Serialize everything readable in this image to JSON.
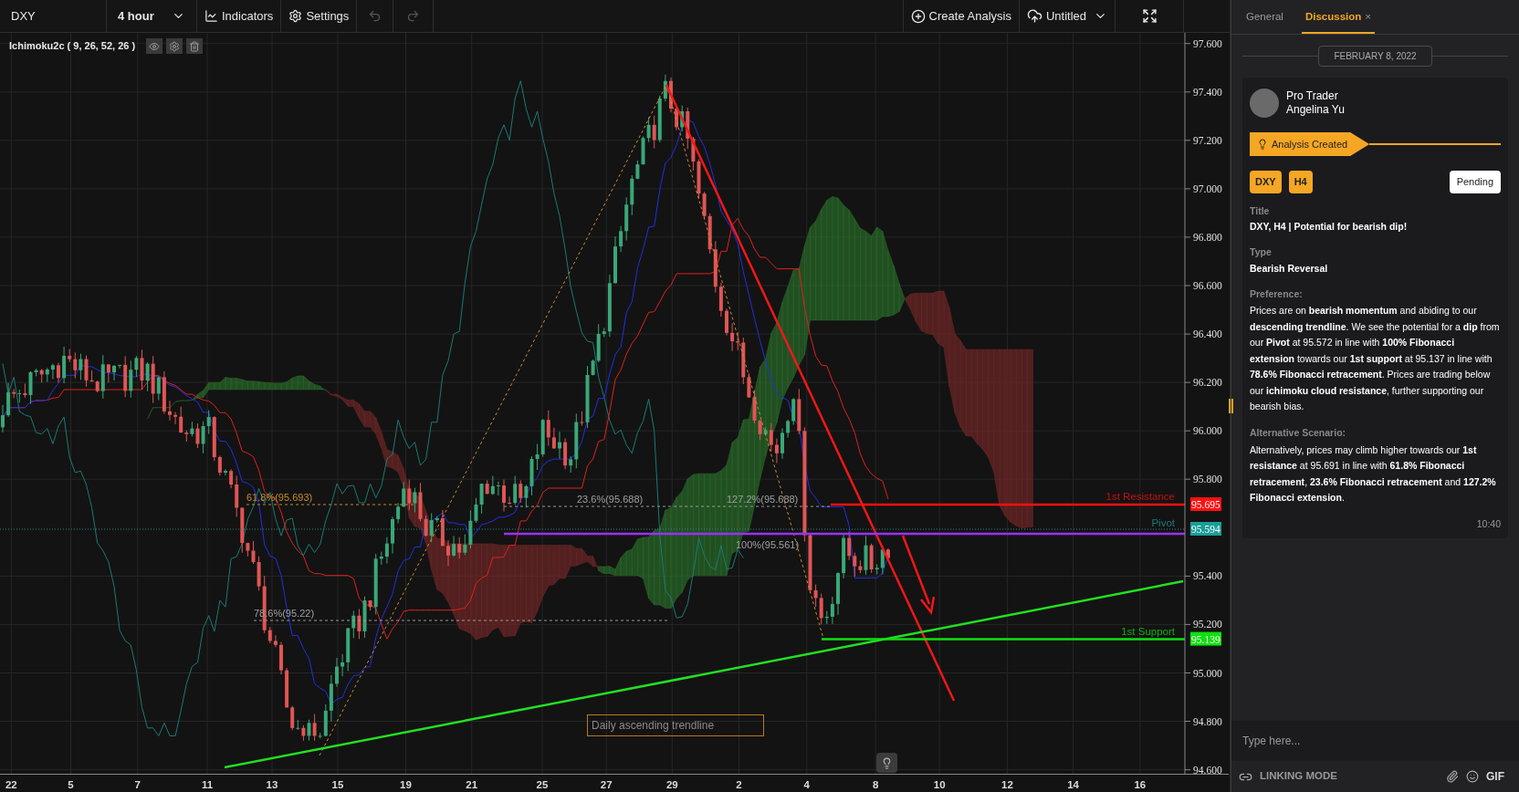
{
  "toolbar": {
    "symbol": "DXY",
    "interval": "4 hour",
    "buttons": [
      {
        "label": "Indicators",
        "kind": "indicators"
      },
      {
        "label": "Settings",
        "kind": "settings"
      }
    ],
    "undo_disabled": true,
    "redo_disabled": true,
    "create": "Create Analysis",
    "layout": "Untitled"
  },
  "chart": {
    "legend": "Ichimoku2c ( 9, 26, 52, 26 )",
    "price_axis": [
      "97.600",
      "97.400",
      "97.200",
      "97.000",
      "96.800",
      "96.600",
      "96.400",
      "96.200",
      "96.000",
      "95.800",
      "95.400",
      "95.200",
      "95.000",
      "94.800",
      "94.600"
    ],
    "time_axis": [
      "22",
      "5",
      "7",
      "11",
      "13",
      "15",
      "19",
      "21",
      "25",
      "27",
      "29",
      "2",
      "4",
      "8",
      "10",
      "12",
      "14",
      "16"
    ],
    "levels": [
      {
        "label": "1st Resistance",
        "tag": "95.695",
        "color": "#ff1010"
      },
      {
        "label": "Pivot",
        "tag": "95.594",
        "color": "#1a9e98"
      },
      {
        "label": "1st Support",
        "tag": "95.139",
        "color": "#10e010"
      }
    ],
    "fib_labels": [
      "61.8%(95.693)",
      "23.6%(95.688)",
      "127.2%(95.688)",
      "100%(95.561)",
      "78.6%(95.22)"
    ],
    "note": "Daily ascending trendline"
  },
  "panel": {
    "tabs": [
      {
        "label": "General",
        "selected": false
      },
      {
        "label": "Discussion",
        "selected": true,
        "close": "×"
      }
    ],
    "date": "FEBRUARY 8, 2022",
    "post": {
      "role": "Pro Trader",
      "name": "Angelina Yu",
      "status": "Analysis Created",
      "tags": [
        "DXY",
        "H4"
      ],
      "state": "Pending",
      "fields": [
        {
          "label": "Title",
          "value": "DXY, H4 | Potential for bearish dip!",
          "kind": "plain"
        },
        {
          "label": "Type",
          "value": "Bearish Reversal",
          "kind": "plain"
        },
        {
          "label": "Preference:",
          "value": "Prices are on **bearish momentum** and abiding to our **descending trendline**. We see the potential for a **dip** from our **Pivot** at 95.572 in line with **100% Fibonacci extension** towards our **1st support** at 95.137 in line with **78.6% Fibonacci retracement**. Prices are trading below our **ichimoku cloud resistance**, further supporting our bearish bias.",
          "kind": "rich"
        },
        {
          "label": "Alternative Scenario:",
          "value": "Alternatively, prices may climb higher towards our **1st resistance** at 95.691 in line with **61.8% Fibonacci retracement**, **23.6% Fibonacci retracement** and **127.2% Fibonacci extension**.",
          "kind": "rich"
        }
      ],
      "time": "10:40"
    },
    "input": {
      "placeholder": "Type here..."
    },
    "footer": {
      "mode": "LINKING MODE",
      "gif": "GIF"
    }
  }
}
